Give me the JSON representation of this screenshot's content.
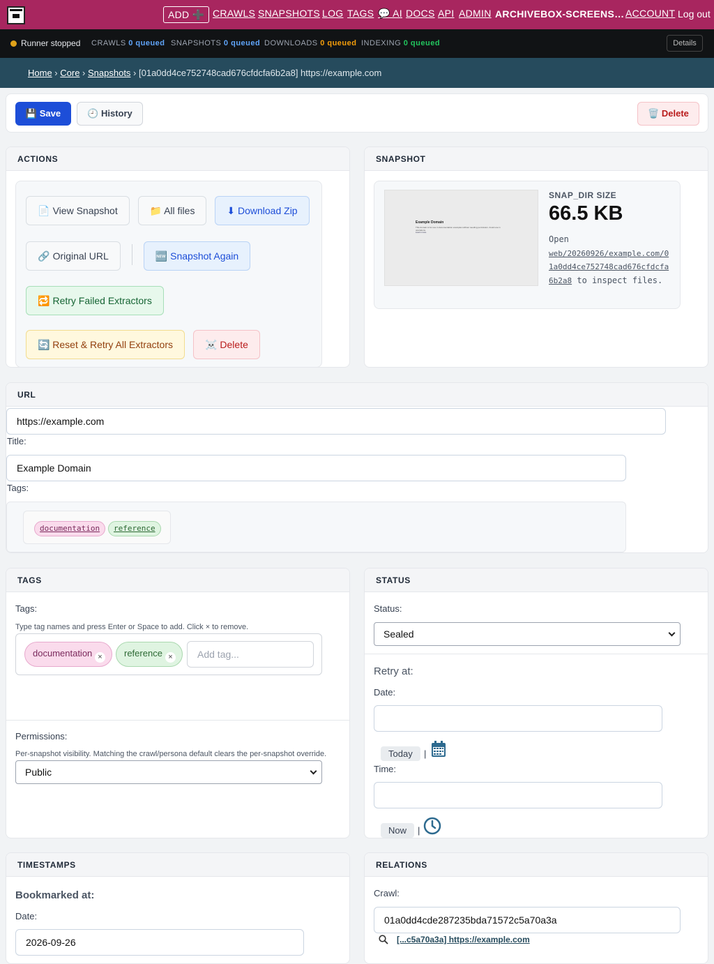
{
  "nav": {
    "add_label": "ADD ➕",
    "links": [
      "CRAWLS",
      "SNAPSHOTS",
      "LOG",
      "TAGS",
      "💬 AI",
      "DOCS",
      "API",
      "ADMIN"
    ],
    "user": "ARCHIVEBOX-SCREENS…",
    "account": "ACCOUNT",
    "logout": "Log out"
  },
  "statusbar": {
    "runner": "Runner stopped",
    "crawls_label": "CRAWLS",
    "crawls_value": "0 queued",
    "snapshots_label": "SNAPSHOTS",
    "snapshots_value": "0 queued",
    "downloads_label": "DOWNLOADS",
    "downloads_value": "0 queued",
    "indexing_label": "INDEXING",
    "indexing_value": "0 queued",
    "details": "Details",
    "colors": {
      "crawls": "#60a5fa",
      "snapshots": "#60a5fa",
      "downloads": "#f59e0b",
      "indexing": "#22c55e",
      "runner_dot": "#e0a21a"
    }
  },
  "breadcrumb": {
    "home": "Home",
    "core": "Core",
    "snapshots": "Snapshots",
    "current": "[01a0dd4ce752748cad676cfdcfa6b2a8] https://example.com"
  },
  "toolbar": {
    "save": "💾 Save",
    "history": "🕘 History",
    "delete": "🗑️ Delete"
  },
  "actions": {
    "title": "ACTIONS",
    "view_snapshot": "📄 View Snapshot",
    "all_files": "📁 All files",
    "download_zip": "⬇ Download Zip",
    "original_url": "🔗 Original URL",
    "snapshot_again": "🆕 Snapshot Again",
    "retry_failed": "🔁 Retry Failed Extractors",
    "reset_retry": "🔄 Reset & Retry All Extractors",
    "delete": "☠️ Delete"
  },
  "snapshot": {
    "title": "SNAPSHOT",
    "thumb_heading": "Example Domain",
    "thumb_text": "This domain is for use in documentation examples without needing permission. Avoid use in operations.",
    "thumb_link": "Learn more",
    "size_label": "SNAP_DIR SIZE",
    "size_value": "66.5 KB",
    "open_text": "Open",
    "path_link": "web/20260926/example.com/01a0dd4ce752748cad676cfdcfa6b2a8",
    "path_suffix": "to inspect files."
  },
  "url_panel": {
    "title": "URL",
    "url_value": "https://example.com",
    "title_label": "Title:",
    "title_value": "Example Domain",
    "tags_label": "Tags:",
    "tags": [
      {
        "name": "documentation",
        "bg": "#fadbec",
        "border": "#e7a9cd",
        "color": "#7a2a5c"
      },
      {
        "name": "reference",
        "bg": "#dff4e1",
        "border": "#a9d8ae",
        "color": "#2e6a35"
      }
    ]
  },
  "tags_panel": {
    "title": "TAGS",
    "tags_label": "Tags:",
    "help": "Type tag names and press Enter or Space to add. Click × to remove.",
    "chips": [
      "documentation",
      "reference"
    ],
    "add_placeholder": "Add tag...",
    "permissions_label": "Permissions:",
    "permissions_help": "Per-snapshot visibility. Matching the crawl/persona default clears the per-snapshot override.",
    "permissions_value": "Public"
  },
  "status_panel": {
    "title": "STATUS",
    "status_label": "Status:",
    "status_value": "Sealed",
    "retry_label": "Retry at:",
    "date_label": "Date:",
    "today": "Today",
    "time_label": "Time:",
    "now": "Now",
    "separator": "|"
  },
  "timestamps_panel": {
    "title": "TIMESTAMPS",
    "bookmarked": "Bookmarked at:",
    "date_label": "Date:",
    "date_value": "2026-09-26"
  },
  "relations_panel": {
    "title": "RELATIONS",
    "crawl_label": "Crawl:",
    "crawl_value": "01a0dd4cde287235bda71572c5a70a3a",
    "crawl_link": "[...c5a70a3a] https://example.com"
  }
}
